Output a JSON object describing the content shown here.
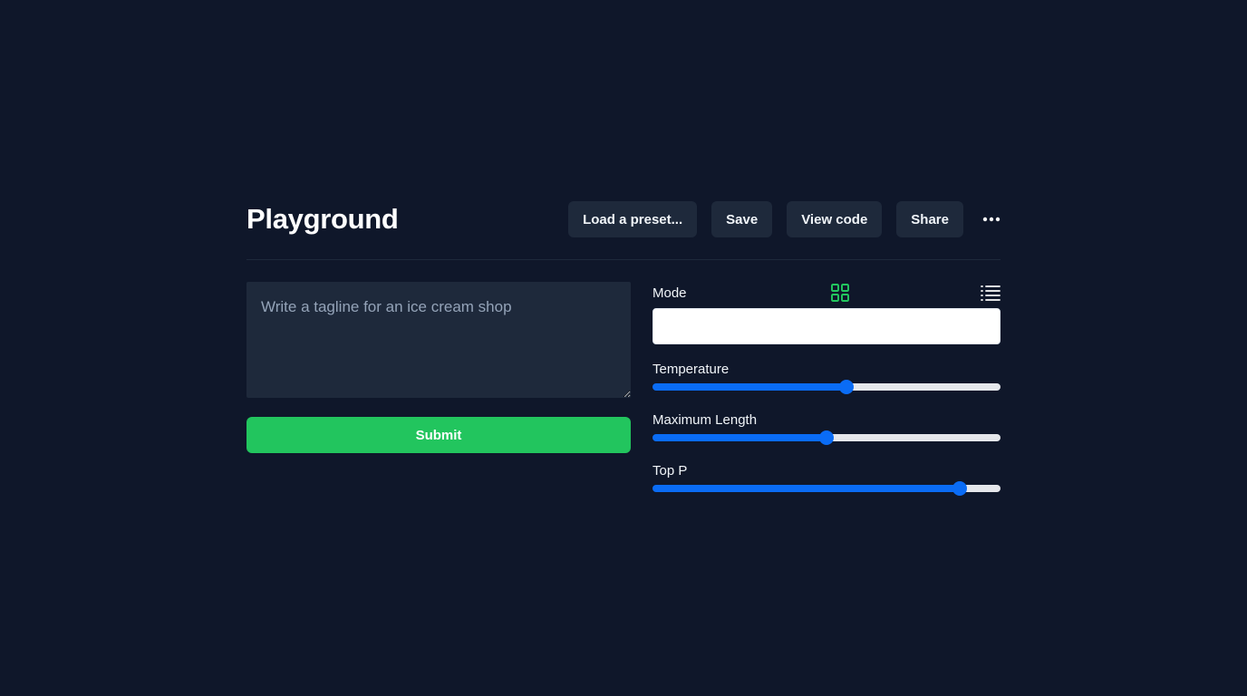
{
  "header": {
    "title": "Playground",
    "buttons": {
      "load_preset": "Load a preset...",
      "save": "Save",
      "view_code": "View code",
      "share": "Share"
    },
    "more_icon": "more-horizontal-icon"
  },
  "prompt": {
    "placeholder": "Write a tagline for an ice cream shop",
    "value": ""
  },
  "submit_label": "Submit",
  "settings": {
    "mode_label": "Mode",
    "mode_icons": [
      "grid-icon",
      "list-icon"
    ],
    "mode_value": "",
    "sliders": [
      {
        "label": "Temperature",
        "value": 56
      },
      {
        "label": "Maximum Length",
        "value": 50
      },
      {
        "label": "Top P",
        "value": 90
      }
    ]
  },
  "colors": {
    "background": "#0f172a",
    "surface": "#1e293b",
    "accent_green": "#22c55e",
    "slider_blue": "#0a6cf5"
  }
}
